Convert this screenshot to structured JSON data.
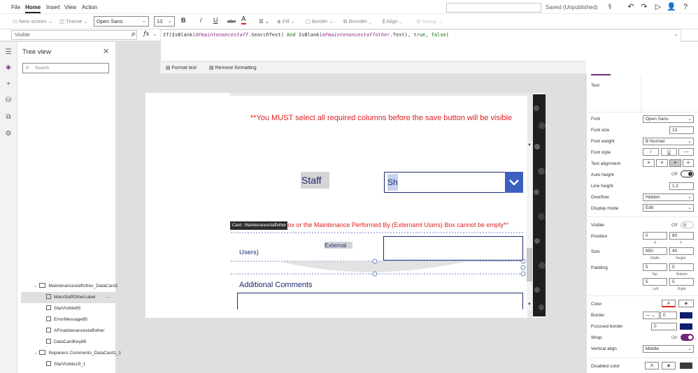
{
  "menu": {
    "file": "File",
    "home": "Home",
    "insert": "Insert",
    "view": "View",
    "action": "Action"
  },
  "status": {
    "saved": "Saved (Unpublished)"
  },
  "ribbon": {
    "new_screen": "New screen",
    "theme": "Theme",
    "font": "Open Sans",
    "font_size": "13",
    "bold": "B",
    "italic": "/",
    "underline": "U",
    "strike": "abc",
    "font_color": "A",
    "fill": "Fill",
    "border": "Border",
    "reorder": "Reorder",
    "align": "Align",
    "group": "Group"
  },
  "formula_bar": {
    "property": "Visible",
    "equals": "=",
    "fx": "fx",
    "formula": {
      "p1": "If(IsBlank(",
      "v1": "AFmaintenancestaff",
      "p2": ".SearchText) ",
      "and": "And",
      "p3": " IsBlank(",
      "v2": "AFmaintenancestaffother",
      "p4": ".Text), ",
      "t": "true",
      "p5": ", ",
      "f": "false",
      "p6": ")"
    },
    "format_text": "Format text",
    "remove_formatting": "Remove formatting"
  },
  "tree": {
    "title": "Tree view",
    "search_placeholder": "Search",
    "items": [
      {
        "label": "Maintenancestaffother_DataCard1"
      },
      {
        "label": "MainStaffOtherLabel"
      },
      {
        "label": "StarVisible85"
      },
      {
        "label": "ErrorMessage85"
      },
      {
        "label": "AFmaintenancestaffother"
      },
      {
        "label": "DataCardKey86"
      },
      {
        "label": "Repairers Comments_DataCard1_1"
      },
      {
        "label": "StarVisible19_1"
      }
    ],
    "more": "···"
  },
  "canvas": {
    "warning1": "**You MUST select all required columns before the save button will be visible",
    "staff_label": "Staff",
    "staff_value": "Sh",
    "warning2": "ff Box or the Maintenance Performed By (Externaml Users) Box cannot be empty**",
    "card_tooltip": "Card : Maintenancestaffother",
    "users_label": "Users)",
    "external_label": "External",
    "additional_comments": "Additional Comments"
  },
  "properties": {
    "text_label": "Text",
    "font_label": "Font",
    "font_value": "Open Sans",
    "font_size_label": "Font size",
    "font_size_value": "13",
    "font_weight_label": "Font weight",
    "font_weight_value": "B  Normal",
    "font_style_label": "Font style",
    "text_alignment_label": "Text alignment",
    "auto_height_label": "Auto height",
    "auto_height_value": "Off",
    "line_height_label": "Line height",
    "line_height_value": "1.2",
    "overflow_label": "Overflow",
    "overflow_value": "Hidden",
    "display_mode_label": "Display mode",
    "display_mode_value": "Edit",
    "visible_label": "Visible",
    "visible_value": "Off",
    "position_label": "Position",
    "position_x": "0",
    "position_y": "80",
    "x_label": "X",
    "y_label": "Y",
    "size_label": "Size",
    "width_value": "850",
    "height_value": "40",
    "width_label": "Width",
    "height_label": "Height",
    "padding_label": "Padding",
    "pad_top": "5",
    "pad_bottom": "5",
    "pad_left": "5",
    "pad_right": "5",
    "top_label": "Top",
    "bottom_label": "Bottom",
    "left_label": "Left",
    "right_label": "Right",
    "color_label": "Color",
    "border_label": "Border",
    "border_width": "0",
    "focused_border_label": "Focused border",
    "focused_border_value": "0",
    "wrap_label": "Wrap",
    "wrap_value": "On",
    "vertical_align_label": "Vertical align",
    "vertical_align_value": "Middle",
    "disabled_color_label": "Disabled color"
  },
  "colors": {
    "accent": "#742774",
    "navy": "#1b2a6b",
    "warning": "#e02020",
    "dropdown_button": "#3c5fc0",
    "border_swatch": "#0d1f6e"
  }
}
